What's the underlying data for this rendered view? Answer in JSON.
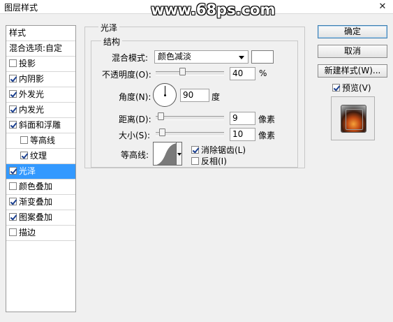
{
  "window": {
    "title": "图层样式",
    "watermark": "www.68ps.com",
    "close_symbol": "✕"
  },
  "sidebar": {
    "header": "样式",
    "blend_options": "混合选项:自定",
    "items": [
      {
        "label": "投影",
        "checked": false
      },
      {
        "label": "内阴影",
        "checked": true
      },
      {
        "label": "外发光",
        "checked": true
      },
      {
        "label": "内发光",
        "checked": true
      },
      {
        "label": "斜面和浮雕",
        "checked": true
      },
      {
        "label": "等高线",
        "checked": false
      },
      {
        "label": "纹理",
        "checked": true
      },
      {
        "label": "光泽",
        "checked": true
      },
      {
        "label": "颜色叠加",
        "checked": false
      },
      {
        "label": "渐变叠加",
        "checked": true
      },
      {
        "label": "图案叠加",
        "checked": true
      },
      {
        "label": "描边",
        "checked": false
      }
    ]
  },
  "satin": {
    "group_title": "光泽",
    "structure_title": "结构",
    "blend_mode_label": "混合模式:",
    "blend_mode_value": "颜色减淡",
    "swatch_color": "#ffffff",
    "opacity_label": "不透明度(O):",
    "opacity_value": "40",
    "opacity_unit": "%",
    "angle_label": "角度(N):",
    "angle_value": "90",
    "angle_unit": "度",
    "distance_label": "距离(D):",
    "distance_value": "9",
    "distance_unit": "像素",
    "size_label": "大小(S):",
    "size_value": "10",
    "size_unit": "像素",
    "contour_label": "等高线:",
    "anti_alias_label": "消除锯齿(L)",
    "anti_alias_checked": true,
    "invert_label": "反相(I)",
    "invert_checked": false
  },
  "buttons": {
    "ok": "确定",
    "cancel": "取消",
    "new_style": "新建样式(W)...",
    "preview_label": "预览(V)",
    "preview_checked": true
  }
}
